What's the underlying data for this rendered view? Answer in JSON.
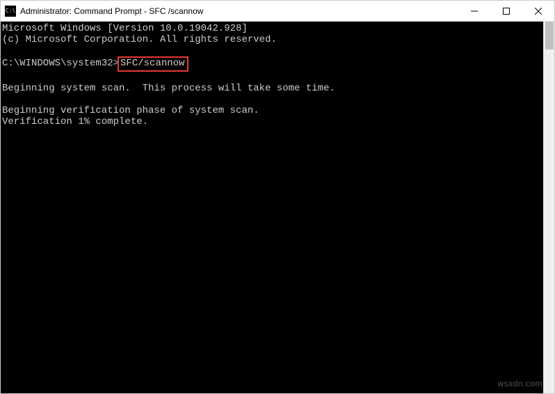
{
  "titlebar": {
    "icon_text": "C:\\",
    "title": "Administrator: Command Prompt - SFC /scannow"
  },
  "terminal": {
    "line_version": "Microsoft Windows [Version 10.0.19042.928]",
    "line_copyright": "(c) Microsoft Corporation. All rights reserved.",
    "prompt_path": "C:\\WINDOWS\\system32>",
    "command": "SFC/scannow",
    "line_scan1": "Beginning system scan.  This process will take some time.",
    "line_scan2": "Beginning verification phase of system scan.",
    "line_scan3": "Verification 1% complete."
  },
  "watermark": "wsxdn.com"
}
